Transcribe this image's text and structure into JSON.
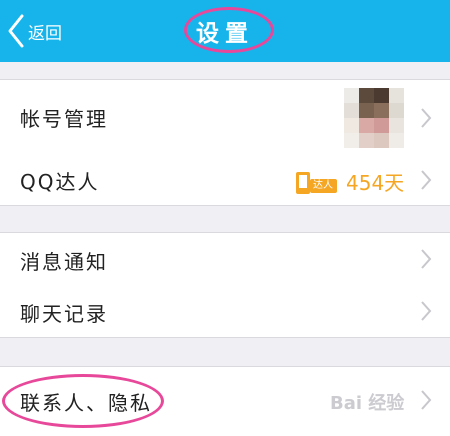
{
  "header": {
    "back_label": "返回",
    "title": "设置"
  },
  "rows": {
    "account": {
      "label": "帐号管理"
    },
    "qq_daren": {
      "label": "QQ达人",
      "badge_text": "达人",
      "value": "454天"
    },
    "notifications": {
      "label": "消息通知"
    },
    "chat_history": {
      "label": "聊天记录"
    },
    "contacts_privacy": {
      "label": "联系人、隐私"
    }
  },
  "watermark": {
    "text": "Bai 经验"
  },
  "colors": {
    "header": "#17b4ec",
    "highlight": "#e8489a",
    "value": "#f5a623",
    "background": "#efeff4"
  },
  "icons": {
    "back": "chevron-left-icon",
    "row_arrow": "chevron-right-icon",
    "badge": "daren-badge-icon"
  }
}
